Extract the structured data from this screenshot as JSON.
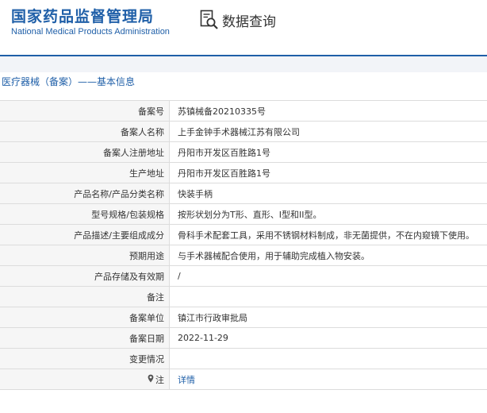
{
  "header": {
    "logo_cn": "国家药品监督管理局",
    "logo_en": "National Medical Products Administration",
    "search_title": "数据查询",
    "search_icon": "document-search-icon",
    "accent_color": "#1f5fa8"
  },
  "breadcrumb": "医疗器械（备案）——基本信息",
  "rows": [
    {
      "label": "备案号",
      "value": "苏镇械备20210335号"
    },
    {
      "label": "备案人名称",
      "value": "上手金钟手术器械江苏有限公司"
    },
    {
      "label": "备案人注册地址",
      "value": "丹阳市开发区百胜路1号"
    },
    {
      "label": "生产地址",
      "value": "丹阳市开发区百胜路1号"
    },
    {
      "label": "产品名称/产品分类名称",
      "value": "快装手柄"
    },
    {
      "label": "型号规格/包装规格",
      "value": "按形状划分为T形、直形、I型和II型。"
    },
    {
      "label": "产品描述/主要组成成分",
      "value": "骨科手术配套工具，采用不锈钢材料制成，非无菌提供，不在内窥镜下使用。"
    },
    {
      "label": "预期用途",
      "value": "与手术器械配合使用，用于辅助完成植入物安装。"
    },
    {
      "label": "产品存储及有效期",
      "value": "/"
    },
    {
      "label": "备注",
      "value": ""
    },
    {
      "label": "备案单位",
      "value": "镇江市行政审批局"
    },
    {
      "label": "备案日期",
      "value": "2022-11-29"
    },
    {
      "label": "变更情况",
      "value": ""
    },
    {
      "label": "注",
      "value": "详情",
      "icon": "location-pin-icon"
    }
  ]
}
